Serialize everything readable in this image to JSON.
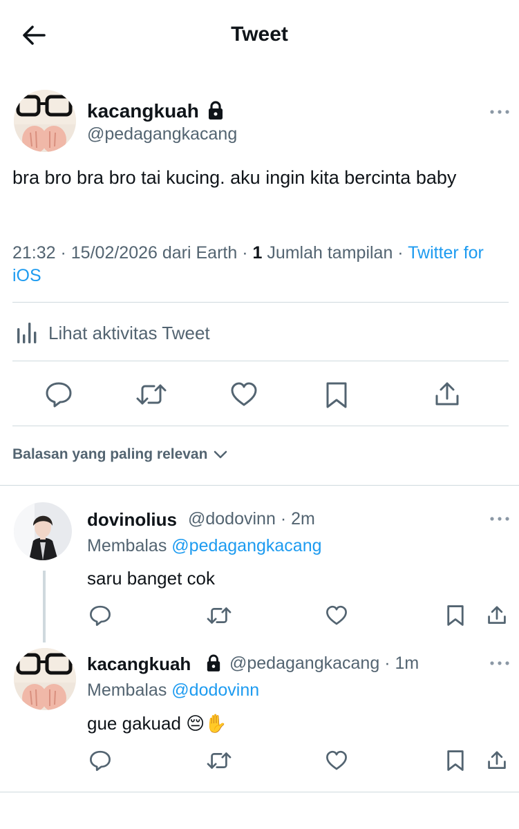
{
  "header": {
    "title": "Tweet",
    "back_icon": "arrow-left-icon"
  },
  "tweet": {
    "name": "kacangkuah",
    "handle": "@pedagangkacang",
    "text": "bra bro bra bro tai kucing. aku ingin kita bercinta baby",
    "time": "21:32",
    "date": "15/02/2026",
    "location": "dari Earth",
    "views_count": "1",
    "views_label": "Jumlah tampilan",
    "source": "Twitter for iOS",
    "activity_label": "Lihat aktivitas Tweet"
  },
  "sort_label": "Balasan yang paling relevan",
  "replies": [
    {
      "name": "dovinolius",
      "handle": "@dodovinn",
      "time": "· 2m",
      "replying_label": "Membalas",
      "replying_to": "@pedagangkacang",
      "text": "saru banget cok"
    },
    {
      "name": "kacangkuah",
      "handle": "@pedagangkacang",
      "time": "· 1m",
      "replying_label": "Membalas",
      "replying_to": "@dodovinn",
      "text": "gue gakuad 😔✋"
    }
  ],
  "colors": {
    "accent": "#1d9bf0",
    "text": "#0f1419",
    "secondary": "#536471",
    "border": "#cfd9de"
  }
}
